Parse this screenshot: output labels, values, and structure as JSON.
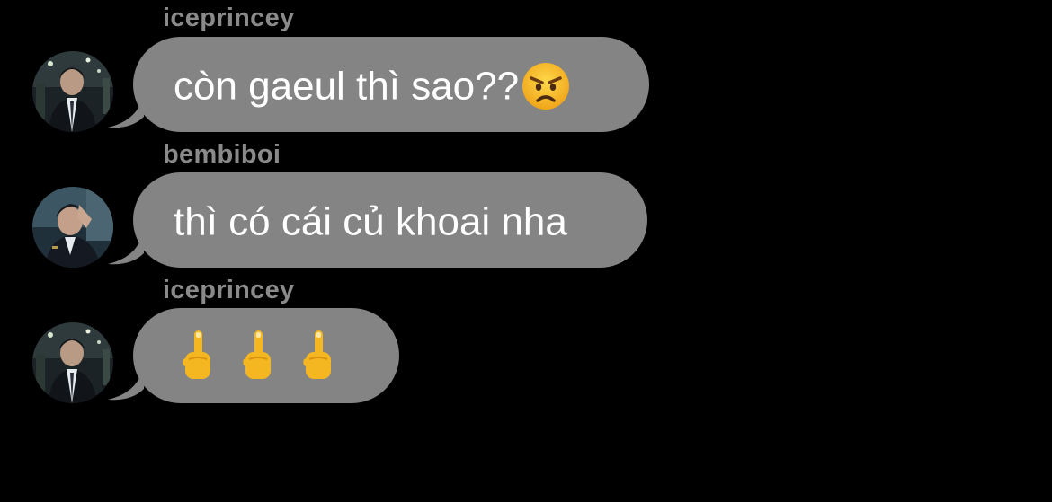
{
  "messages": [
    {
      "sender": "iceprincey",
      "text": "còn gaeul thì sao??",
      "emoji_trailing": "angry-face-icon"
    },
    {
      "sender": "bembiboi",
      "text": "thì có cái củ khoai nha",
      "emoji_trailing": ""
    },
    {
      "sender": "iceprincey",
      "text": "",
      "emojis": [
        "middle-finger-icon",
        "middle-finger-icon",
        "middle-finger-icon"
      ]
    }
  ],
  "colors": {
    "background": "#000000",
    "bubble": "#848484",
    "sender_name": "#8a8a8a",
    "text": "#ffffff"
  }
}
